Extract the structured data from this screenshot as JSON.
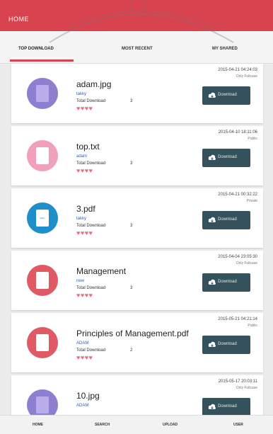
{
  "appbar": {
    "title": "HOME"
  },
  "tabs": [
    {
      "label": "TOP DOWNLOAD",
      "active": true
    },
    {
      "label": "MOST RECENT",
      "active": false
    },
    {
      "label": "MY SHARED",
      "active": false
    }
  ],
  "files": [
    {
      "name": "adam.jpg",
      "user": "takky",
      "downloads_label": "Total Download",
      "downloads": "3",
      "hearts": "♥♥♥♥",
      "timestamp": "2015-04-21 04:24:03",
      "visibility": "Only Fullcase",
      "button_label": "Download",
      "icon_color": "#8f7fd0",
      "doc_label": ""
    },
    {
      "name": "top.txt",
      "user": "adam",
      "downloads_label": "Total Download",
      "downloads": "3",
      "hearts": "♥♥♥♥",
      "timestamp": "2015-04-10 18:11:06",
      "visibility": "Public",
      "button_label": "Download",
      "icon_color": "#f0a0bc",
      "doc_label": ""
    },
    {
      "name": "3.pdf",
      "user": "takky",
      "downloads_label": "Total Download",
      "downloads": "3",
      "hearts": "♥♥♥♥",
      "timestamp": "2015-04-21 00:32:22",
      "visibility": "Private",
      "button_label": "Download",
      "icon_color": "#1f8fc9",
      "doc_label": "takky"
    },
    {
      "name": "Management",
      "user": "new",
      "downloads_label": "Total Download",
      "downloads": "3",
      "hearts": "♥♥♥♥",
      "timestamp": "2015-04-04 23:05:30",
      "visibility": "Only Fullcase",
      "button_label": "Download",
      "icon_color": "#e05a66",
      "doc_label": ""
    },
    {
      "name": "Principles of Management.pdf",
      "user": "ADAM",
      "downloads_label": "Total Download",
      "downloads": "2",
      "hearts": "♥♥♥♥",
      "timestamp": "2015-05-21 04:21:14",
      "visibility": "Public",
      "button_label": "Download",
      "icon_color": "#e05a66",
      "doc_label": ""
    },
    {
      "name": "10.jpg",
      "user": "ADAM",
      "downloads_label": "Total Download",
      "downloads": "",
      "hearts": "",
      "timestamp": "2015-05-17 20:03:11",
      "visibility": "Only Fullcase",
      "button_label": "Download",
      "icon_color": "#8f7fd0",
      "doc_label": ""
    }
  ],
  "bottom_nav": [
    {
      "label": "HOME"
    },
    {
      "label": "SEARCH"
    },
    {
      "label": "UPLOAD"
    },
    {
      "label": "USER"
    }
  ],
  "colors": {
    "accent": "#d9434f",
    "button": "#35525c",
    "link": "#2a5fbf"
  },
  "icons": {
    "file": "file-icon",
    "download": "cloud-download-icon"
  }
}
